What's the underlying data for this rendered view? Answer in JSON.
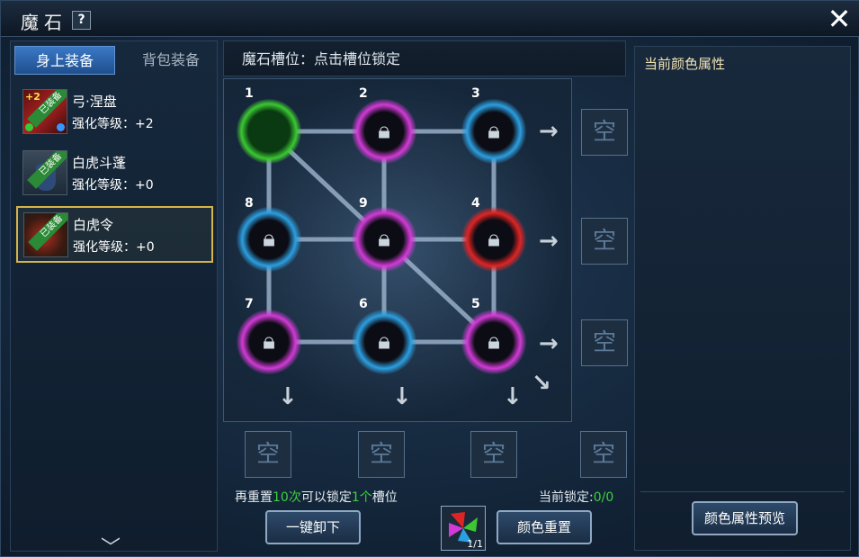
{
  "window": {
    "title": "魔石",
    "help_label": "?",
    "close_label": "✕"
  },
  "tabs": [
    {
      "label": "身上装备",
      "active": true
    },
    {
      "label": "背包装备",
      "active": false
    }
  ],
  "equipment": [
    {
      "name": "弓·涅盘",
      "level": "强化等级：+2",
      "badge": "已装备",
      "level_tag": "+2",
      "selected": false
    },
    {
      "name": "白虎斗蓬",
      "level": "强化等级：+0",
      "badge": "已装备",
      "selected": false
    },
    {
      "name": "白虎令",
      "level": "强化等级：+0",
      "badge": "已装备",
      "selected": true
    }
  ],
  "slot_header": "魔石槽位：点击槽位锁定",
  "slots": [
    {
      "num": "1",
      "color": "green",
      "locked": false
    },
    {
      "num": "2",
      "color": "magenta",
      "locked": true
    },
    {
      "num": "3",
      "color": "blue",
      "locked": true
    },
    {
      "num": "4",
      "color": "red",
      "locked": true
    },
    {
      "num": "5",
      "color": "magenta",
      "locked": true
    },
    {
      "num": "6",
      "color": "blue",
      "locked": true
    },
    {
      "num": "7",
      "color": "magenta",
      "locked": true
    },
    {
      "num": "8",
      "color": "blue",
      "locked": true
    },
    {
      "num": "9",
      "color": "magenta",
      "locked": true
    }
  ],
  "empty_label": "空",
  "reset_info": {
    "prefix": "再重置",
    "count": "10次",
    "mid": "可以锁定",
    "slots": "1个",
    "suffix": "槽位"
  },
  "lock_info": {
    "label": "当前锁定:",
    "value": "0/0"
  },
  "buttons": {
    "unequip": "一键卸下",
    "color_reset": "颜色重置",
    "preview": "颜色属性预览"
  },
  "color_item_count": "1/1",
  "right_panel": {
    "title": "当前颜色属性"
  },
  "colors": {
    "green": "#3cc832",
    "magenta": "#d23ad6",
    "blue": "#2c9fe0",
    "red": "#e02424",
    "gold": "#d7b44a"
  }
}
